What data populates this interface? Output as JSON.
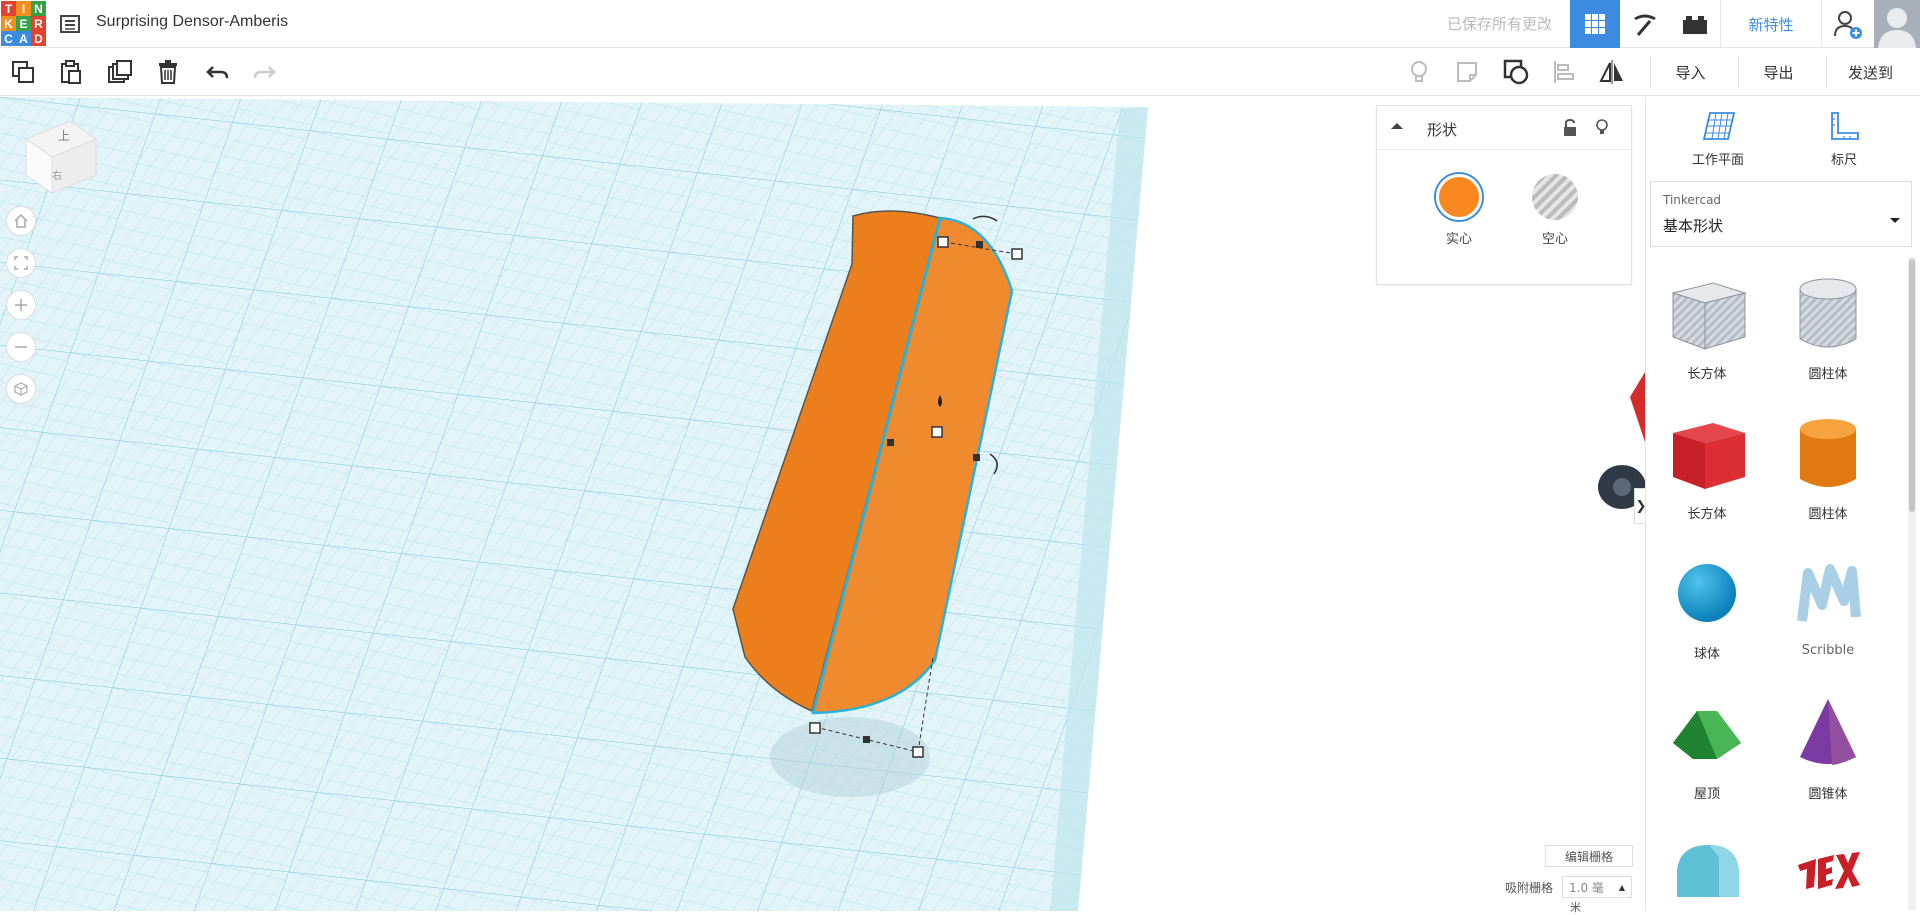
{
  "header": {
    "logo_letters": [
      "T",
      "I",
      "N",
      "K",
      "E",
      "R",
      "C",
      "A",
      "D"
    ],
    "design_title": "Surprising Densor-Amberis",
    "saved_status": "已保存所有更改",
    "new_features": "新特性",
    "active_view": "3D design grid",
    "accent_color": "#3c8be0"
  },
  "toolbar": {
    "left_tools": [
      "copy-icon",
      "paste-icon",
      "duplicate-icon",
      "delete-icon",
      "undo-icon",
      "redo-icon"
    ],
    "right_tools": [
      "light-bulb-icon",
      "note-icon",
      "group-icon",
      "align-icon",
      "mirror-icon"
    ],
    "import_label": "导入",
    "export_label": "导出",
    "send_to_label": "发送到"
  },
  "viewcube": {
    "front_label": "上",
    "side_label": "右"
  },
  "nav_controls": [
    "home-icon",
    "fit-icon",
    "zoom-in-icon",
    "zoom-out-icon",
    "perspective-icon"
  ],
  "inspector": {
    "title": "形状",
    "solid_label": "实心",
    "hole_label": "空心",
    "solid_color": "#f7871e",
    "selected": "solid"
  },
  "workplane": {
    "edit_grid_label": "编辑栅格",
    "snap_grid_label": "吸附栅格",
    "snap_grid_value": "1.0 毫",
    "snap_grid_unit": "米"
  },
  "right_panel": {
    "workplane_label": "工作平面",
    "ruler_label": "标尺",
    "category_source": "Tinkercad",
    "category_name": "基本形状",
    "shapes": [
      {
        "name": "长方体",
        "kind": "box-striped"
      },
      {
        "name": "圆柱体",
        "kind": "cylinder-striped"
      },
      {
        "name": "长方体",
        "kind": "box-red"
      },
      {
        "name": "圆柱体",
        "kind": "cylinder-orange"
      },
      {
        "name": "球体",
        "kind": "sphere-blue"
      },
      {
        "name": "Scribble",
        "kind": "scribble"
      },
      {
        "name": "屋顶",
        "kind": "roof-green"
      },
      {
        "name": "圆锥体",
        "kind": "cone-purple"
      },
      {
        "name": "",
        "kind": "round-roof"
      },
      {
        "name": "",
        "kind": "text-red"
      }
    ]
  }
}
